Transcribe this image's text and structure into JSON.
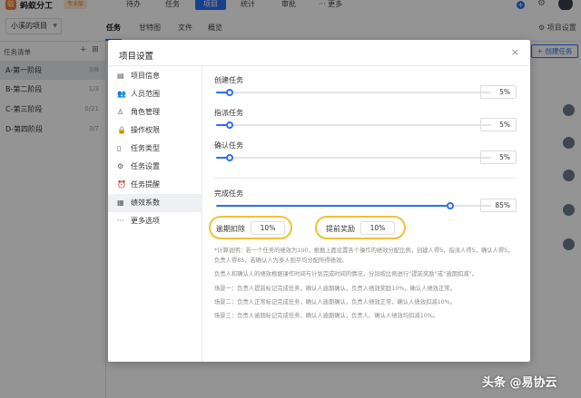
{
  "app": {
    "name": "蚂蚁分工",
    "badge": "专业版"
  },
  "nav": {
    "items": [
      "待办",
      "任务",
      "项目",
      "统计",
      "审批",
      "··· 更多"
    ],
    "active_index": 2
  },
  "subbar": {
    "project_select": "小溪的项目",
    "tabs": [
      "任务",
      "甘特图",
      "文件",
      "概览"
    ],
    "settings_label": "项目设置"
  },
  "left_panel": {
    "header": "任务清单",
    "stages": [
      {
        "name": "A-第一阶段",
        "count": "3/8"
      },
      {
        "name": "B-第二阶段",
        "count": "1/3"
      },
      {
        "name": "C-第三阶段",
        "count": "0/21"
      },
      {
        "name": "D-第四阶段",
        "count": "3/7"
      }
    ]
  },
  "create_task_label": "+ 创建任务",
  "modal": {
    "title": "项目设置",
    "close_icon": "×",
    "menu": [
      {
        "label": "项目信息",
        "icon": "document-icon"
      },
      {
        "label": "人员范围",
        "icon": "users-icon"
      },
      {
        "label": "角色管理",
        "icon": "user-icon"
      },
      {
        "label": "操作权限",
        "icon": "lock-icon"
      },
      {
        "label": "任务类型",
        "icon": "file-icon"
      },
      {
        "label": "任务设置",
        "icon": "gear-icon"
      },
      {
        "label": "任务提醒",
        "icon": "alarm-icon"
      },
      {
        "label": "绩效系数",
        "icon": "chart-icon"
      },
      {
        "label": "更多选项",
        "icon": "ellipsis-icon"
      }
    ],
    "active_menu_index": 7,
    "sliders": [
      {
        "label": "创建任务",
        "value": "5%",
        "level_percent": 5
      },
      {
        "label": "指派任务",
        "value": "5%",
        "level_percent": 5
      },
      {
        "label": "确认任务",
        "value": "5%",
        "level_percent": 5
      },
      {
        "label": "完成任务",
        "value": "85%",
        "level_percent": 85
      }
    ],
    "penalty": {
      "label": "逾期扣除",
      "value": "10%"
    },
    "reward": {
      "label": "提前奖励",
      "value": "10%"
    },
    "notes": [
      "*计算说明：若一个任务的绩效为100，根据上面设置各个操作的绩效分配比例，创建人得5，指派人得5，确认人得5，负责人得85，若确认人为多人则平均分配所得绩效。",
      "负责人和确认人的绩效根据操作时间与计划完成时间的情况，分别按比例进行“提前奖励”或“逾期扣减”。",
      "场景一：负责人提前标记完成任务，确认人逾期确认，负责人绩效奖励10%，确认人绩效正常。",
      "场景二：负责人正常标记完成任务，确认人逾期确认，负责人绩效正常，确认人绩效扣减10%。",
      "场景三：负责人逾期标记完成任务，确认人逾期确认，负责人、确认人绩效均扣减10%。"
    ]
  },
  "watermark": "头条 @易协云",
  "colors": {
    "accent": "#2c6ef2",
    "highlight": "#f0c03a",
    "logo": "#f07b2f"
  }
}
